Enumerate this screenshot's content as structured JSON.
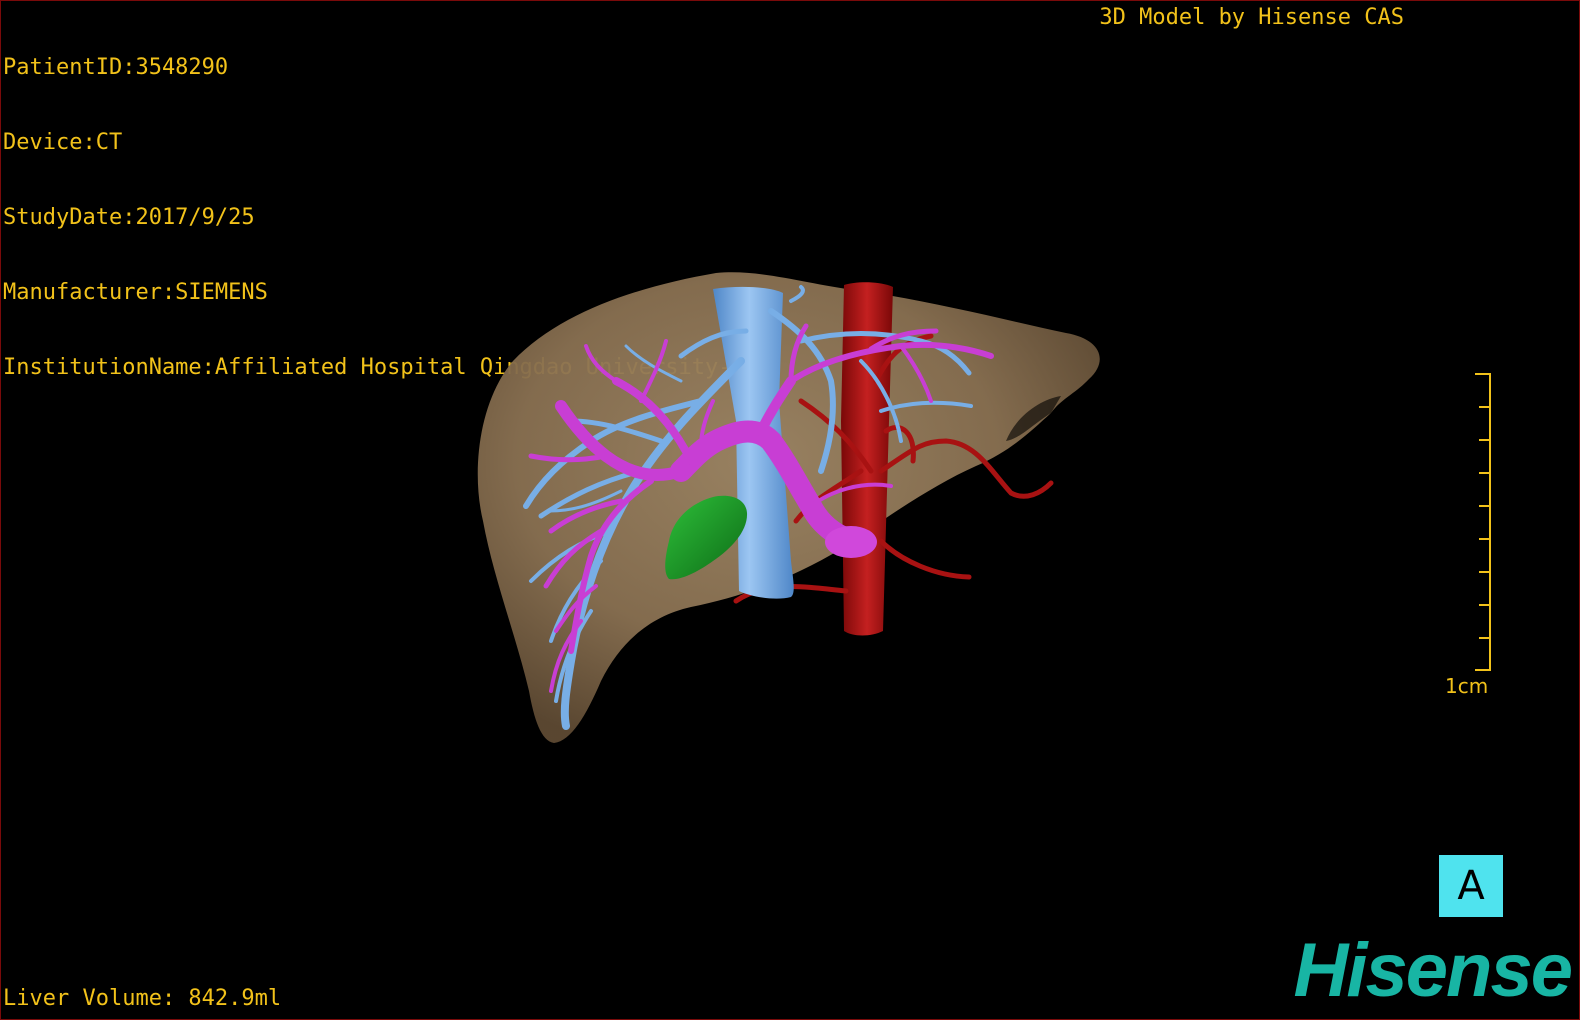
{
  "header": {
    "patient_id": "PatientID:3548290",
    "device": "Device:CT",
    "study_date": "StudyDate:2017/9/25",
    "manufacturer": "Manufacturer:SIEMENS",
    "institution": "InstitutionName:Affiliated Hospital Qingdao University-C"
  },
  "brand_text": "3D Model by Hisense CAS",
  "liver_volume": "Liver Volume: 842.9ml",
  "scale_label": "1cm",
  "orientation_label": "A",
  "logo": "Hisense",
  "colors": {
    "overlay_text": "#f2c21a",
    "liver": "#8a7152",
    "hepatic_vein": "#76a9df",
    "portal_vein": "#c43fd0",
    "artery": "#b01616",
    "gallbladder": "#1e9a2a",
    "orientation_box": "#4fe3ee",
    "logo": "#18b5a4"
  }
}
